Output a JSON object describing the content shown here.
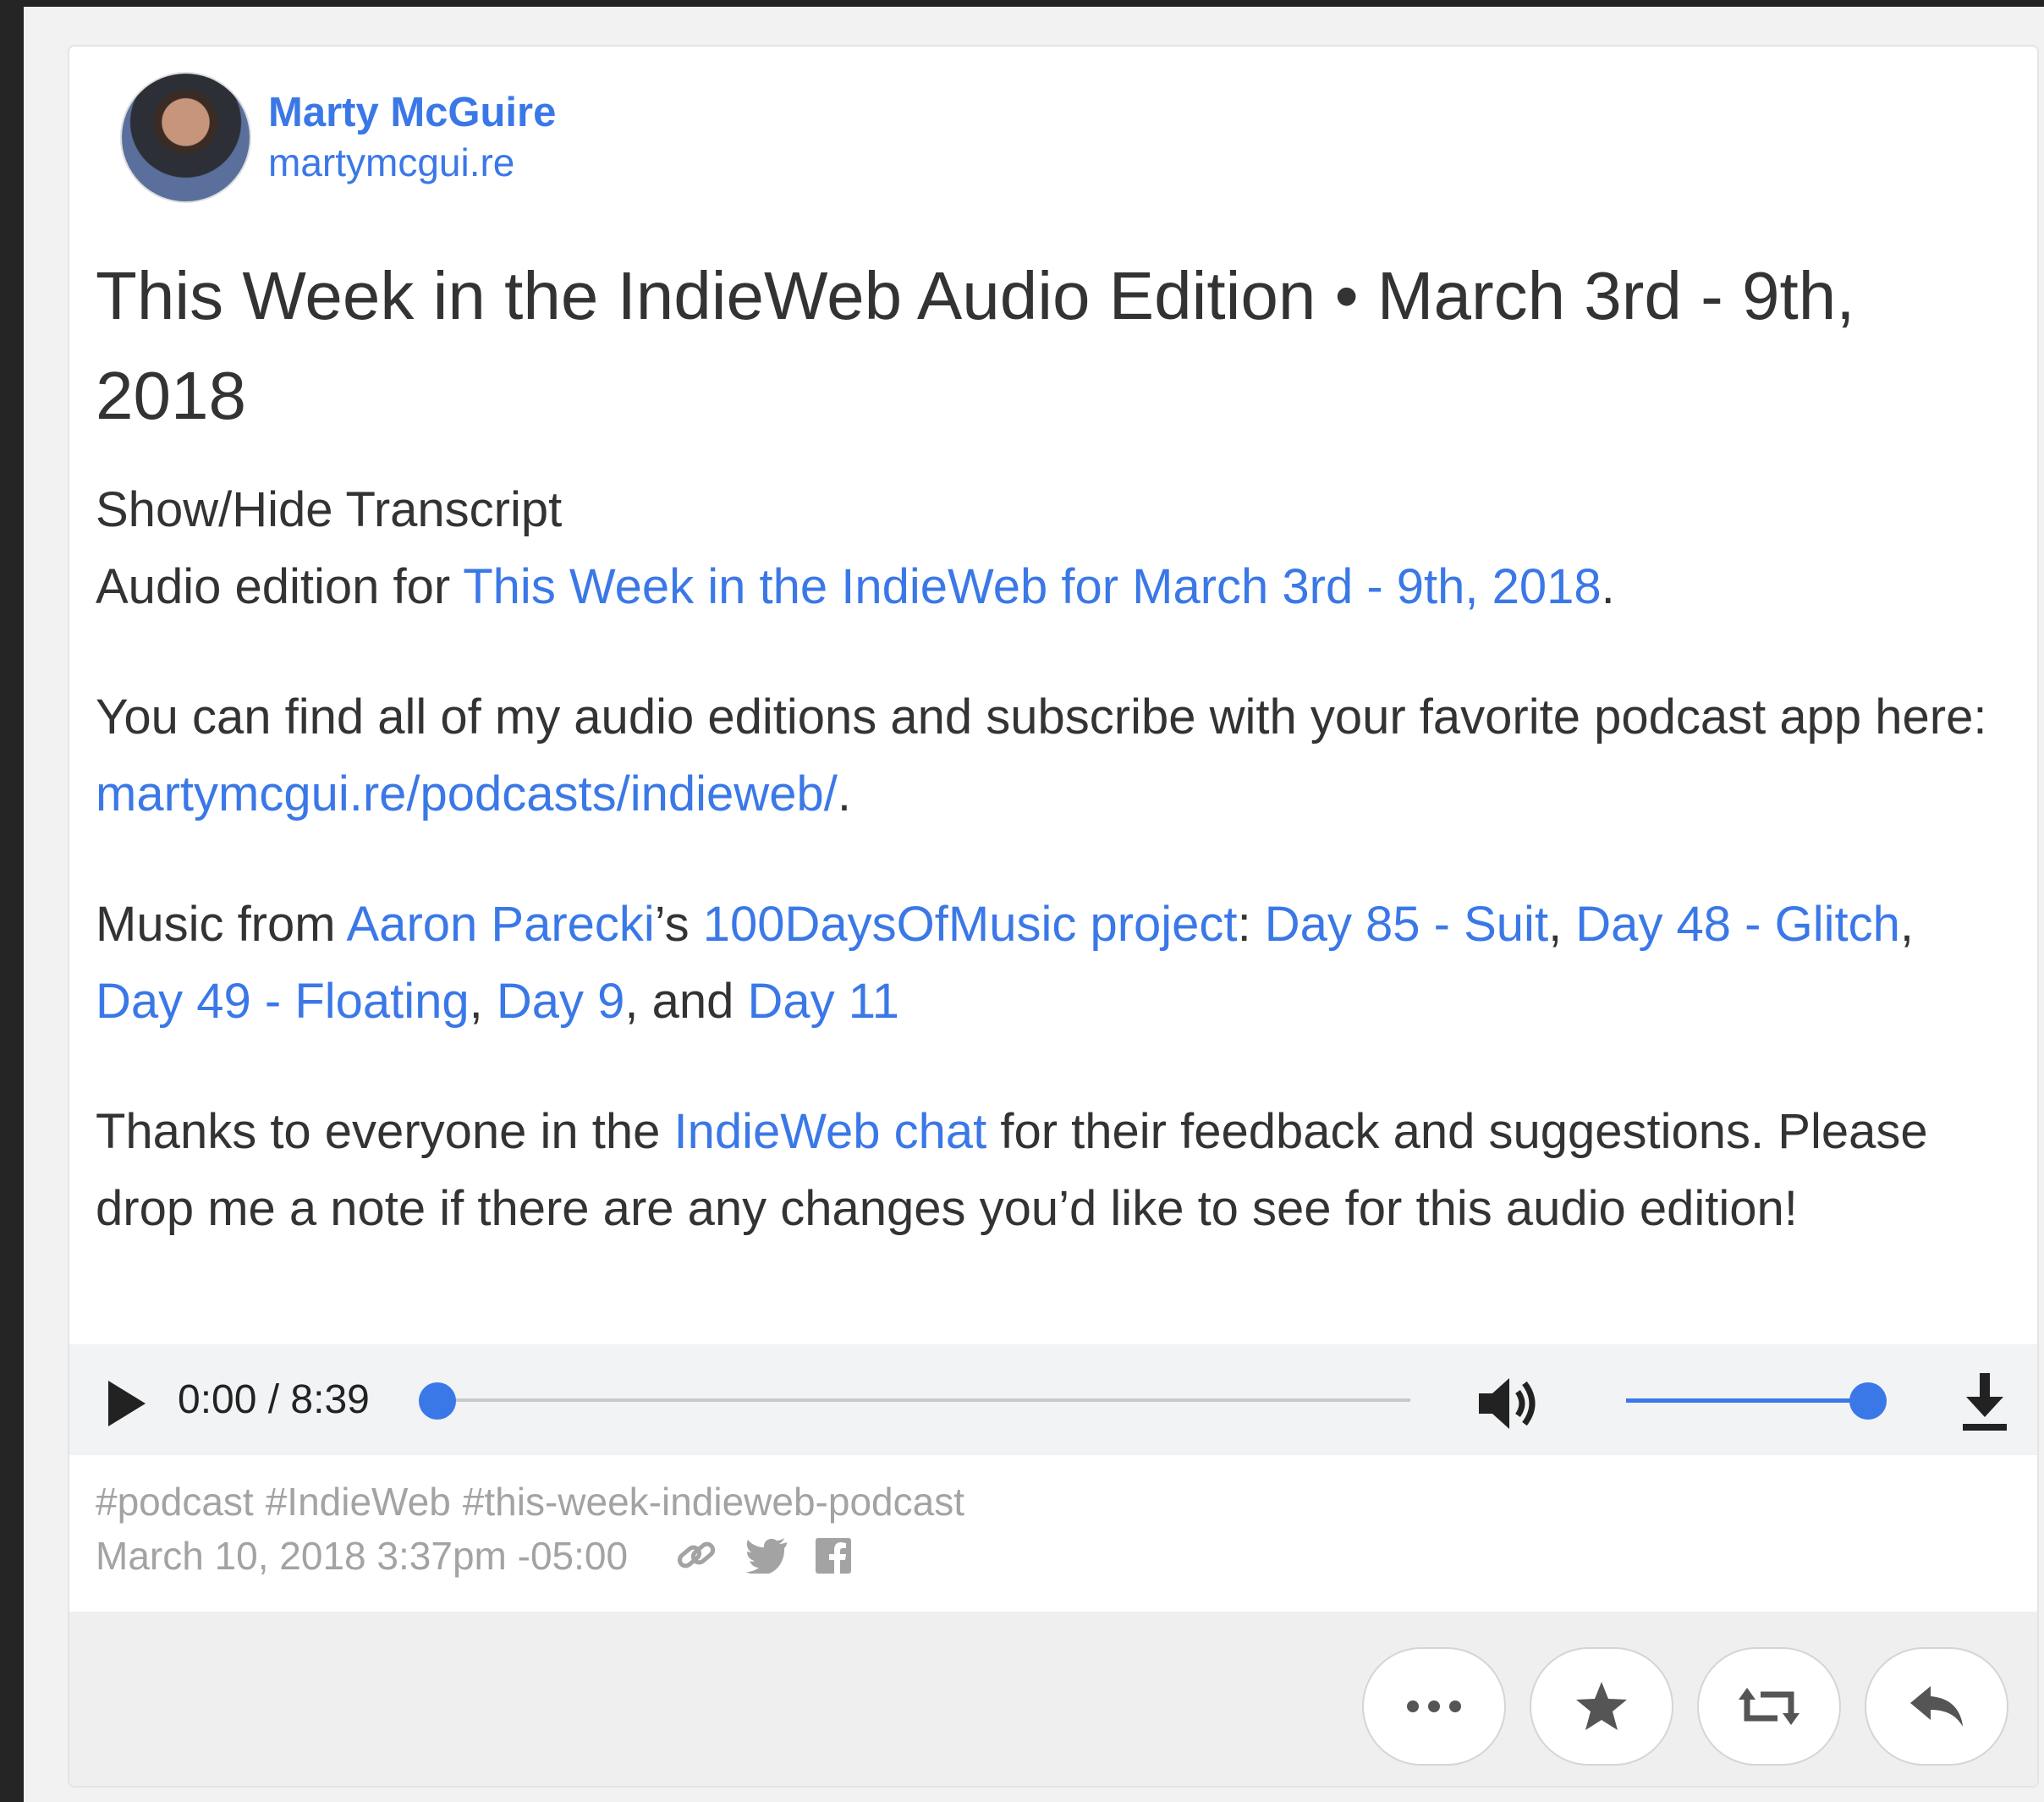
{
  "author": {
    "name": "Marty McGuire",
    "url": "martymcgui.re"
  },
  "post": {
    "title": "This Week in the IndieWeb Audio Edition • March 3rd - 9th, 2018",
    "transcript_toggle": "Show/Hide Transcript",
    "p1_prefix": "Audio edition for ",
    "p1_link": "This Week in the IndieWeb for March 3rd - 9th, 2018",
    "p1_suffix": ".",
    "p2_prefix": "You can find all of my audio editions and subscribe with your favorite podcast app here: ",
    "p2_link": "martymcgui.re/podcasts/indieweb/",
    "p2_suffix": ".",
    "p3_prefix": "Music from ",
    "p3_link_aaron": "Aaron Parecki",
    "p3_apostrophe": "’s ",
    "p3_link_project": "100DaysOfMusic project",
    "p3_colon": ": ",
    "p3_link_day85": "Day 85 - Suit",
    "p3_sep1": ", ",
    "p3_link_day48": "Day 48 - Glitch",
    "p3_sep2": ", ",
    "p3_link_day49": "Day 49 - Floating",
    "p3_sep3": ", ",
    "p3_link_day9": "Day 9",
    "p3_and": ", and ",
    "p3_link_day11": "Day 11",
    "p4_prefix": "Thanks to everyone in the ",
    "p4_link": "IndieWeb chat",
    "p4_suffix": " for their feedback and suggestions. Please drop me a note if there are any changes you’d like to see for this audio edition!"
  },
  "player": {
    "time": "0:00 / 8:39",
    "progress": 0,
    "volume": 1.0
  },
  "tags": [
    "#podcast",
    "#IndieWeb",
    "#this-week-indieweb-podcast"
  ],
  "timestamp": "March 10, 2018 3:37pm -05:00",
  "icons": {
    "meta": [
      "link-icon",
      "twitter-icon",
      "facebook-icon"
    ],
    "actions": [
      "more-icon",
      "star-icon",
      "repost-icon",
      "reply-icon"
    ]
  },
  "colors": {
    "link": "#3b78e7",
    "text": "#333333",
    "muted": "#a3a3a3",
    "background": "#252525"
  }
}
